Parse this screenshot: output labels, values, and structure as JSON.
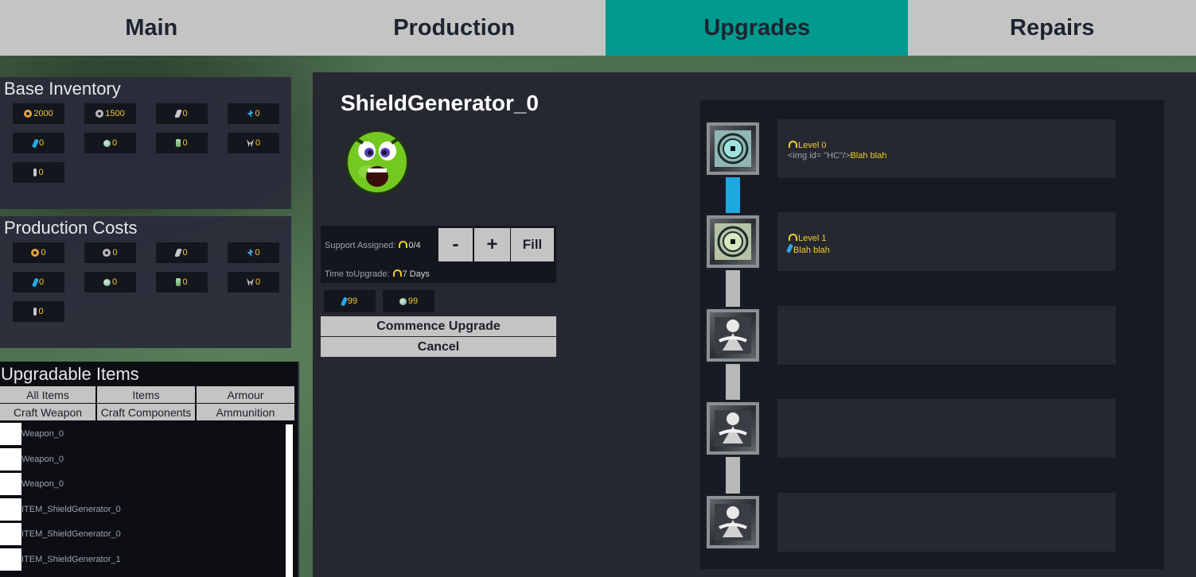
{
  "tabs": [
    "Main",
    "Production",
    "Upgrades",
    "Repairs"
  ],
  "active_tab": "Upgrades",
  "base_inventory": {
    "title": "Base Inventory",
    "resources": [
      {
        "icon": "gear-icon",
        "value": "2000"
      },
      {
        "icon": "cog-icon",
        "value": "1500"
      },
      {
        "icon": "bolt-icon",
        "value": "0"
      },
      {
        "icon": "lightning-icon",
        "value": "0"
      },
      {
        "icon": "vial-icon",
        "value": "0"
      },
      {
        "icon": "orb-icon",
        "value": "0"
      },
      {
        "icon": "bottle-icon",
        "value": "0"
      },
      {
        "icon": "claw-icon",
        "value": "0"
      },
      {
        "icon": "feather-icon",
        "value": "0"
      }
    ]
  },
  "production_costs": {
    "title": "Production Costs",
    "resources": [
      {
        "icon": "gear-icon",
        "value": "0"
      },
      {
        "icon": "cog-icon",
        "value": "0"
      },
      {
        "icon": "bolt-icon",
        "value": "0"
      },
      {
        "icon": "lightning-icon",
        "value": "0"
      },
      {
        "icon": "vial-icon",
        "value": "0"
      },
      {
        "icon": "orb-icon",
        "value": "0"
      },
      {
        "icon": "bottle-icon",
        "value": "0"
      },
      {
        "icon": "claw-icon",
        "value": "0"
      },
      {
        "icon": "feather-icon",
        "value": "0"
      }
    ]
  },
  "upgradable_items": {
    "title": "Upgradable Items",
    "filters": [
      "All Items",
      "Items",
      "Armour",
      "Craft Weapon",
      "Craft Components",
      "Ammunition"
    ],
    "items": [
      "Weapon_0",
      "Weapon_0",
      "Weapon_0",
      "ITEM_ShieldGenerator_0",
      "ITEM_ShieldGenerator_0",
      "ITEM_ShieldGenerator_1"
    ]
  },
  "selected_item": {
    "name": "ShieldGenerator_0",
    "portrait": "green-face-icon",
    "support_label": "Support Assigned:",
    "support_value": "0/4",
    "time_label": "Time toUpgrade:",
    "time_value": "7 Days",
    "buttons": {
      "minus": "-",
      "plus": "+",
      "fill": "Fill"
    },
    "costs": [
      {
        "icon": "vial-icon",
        "value": "99"
      },
      {
        "icon": "orb-icon",
        "value": "99"
      }
    ],
    "commence_label": "Commence Upgrade",
    "cancel_label": "Cancel"
  },
  "levels": [
    {
      "title": "Level 0",
      "code": "<img id= \"HC\"/>",
      "desc": "Blah blah",
      "icon": "shield-eye-icon",
      "unlocked": true
    },
    {
      "title": "Level 1",
      "code": "",
      "desc": "Blah blah",
      "icon": "shield-eye-icon",
      "unlocked": true
    },
    {
      "title": "",
      "code": "",
      "desc": "",
      "icon": "locked-figure-icon",
      "unlocked": false
    },
    {
      "title": "",
      "code": "",
      "desc": "",
      "icon": "locked-figure-icon",
      "unlocked": false
    },
    {
      "title": "",
      "code": "",
      "desc": "",
      "icon": "locked-figure-icon",
      "unlocked": false
    }
  ],
  "colors": {
    "accent": "#009a8e",
    "value_text": "#f0cc2a",
    "connector_active": "#1ea8e0",
    "connector_locked": "#b8b8b8"
  }
}
